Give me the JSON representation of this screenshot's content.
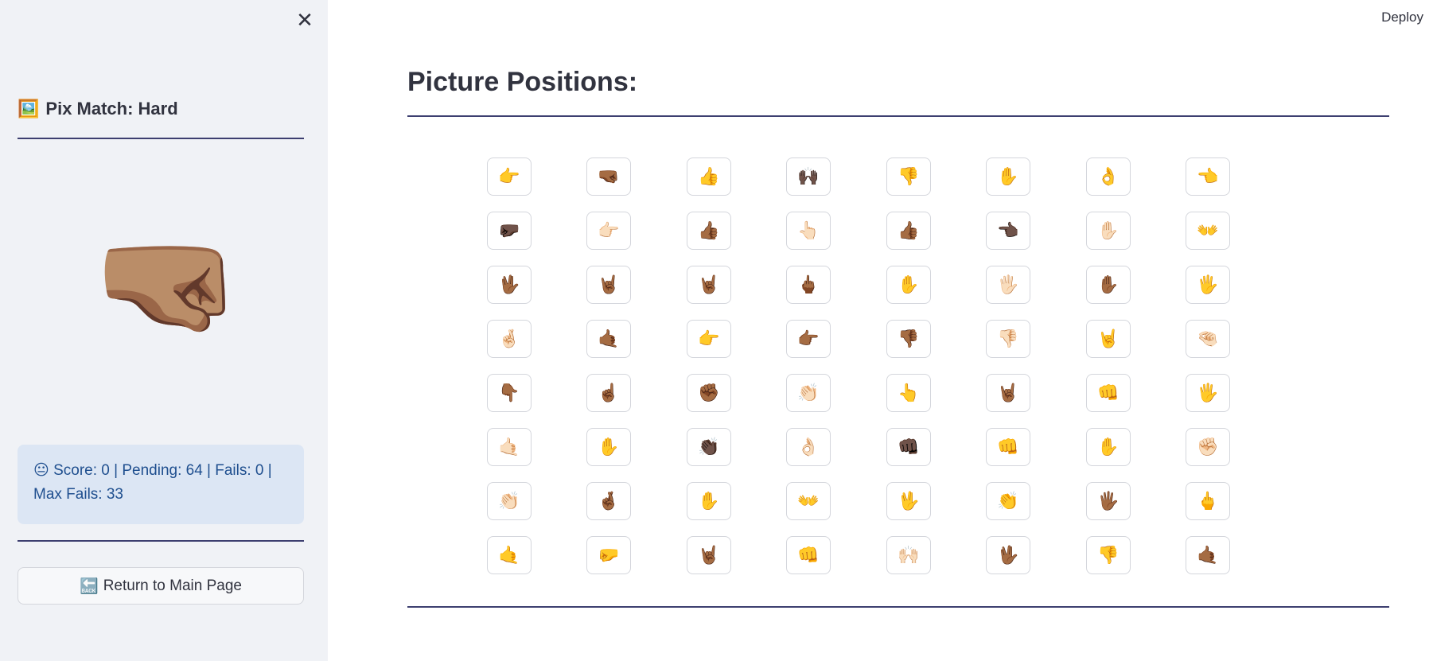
{
  "sidebar": {
    "close_icon": "✕",
    "title_icon": "🖼️",
    "title": "Pix Match: Hard",
    "target_emoji": "🤜🏽",
    "status_icon": "😐",
    "status_text": "Score: 0 | Pending: 64 | Fails: 0 | Max Fails: 33",
    "return_icon": "🔙",
    "return_label": "Return to Main Page"
  },
  "header": {
    "deploy_label": "Deploy"
  },
  "main": {
    "title": "Picture Positions:",
    "rows": [
      [
        "👉",
        "🤜🏾",
        "👍",
        "🙌🏿",
        "👎",
        "✋",
        "👌",
        "👈"
      ],
      [
        "🤛🏿",
        "👉🏻",
        "👍🏾",
        "👆🏻",
        "👍🏾",
        "👈🏿",
        "✋🏻",
        "👐"
      ],
      [
        "🖖🏾",
        "🤘🏾",
        "🤘🏾",
        "🖕🏾",
        "✋",
        "🖐🏻",
        "✋🏾",
        "🖐"
      ],
      [
        "🤞🏻",
        "🤙🏾",
        "👉",
        "👉🏾",
        "👎🏾",
        "👎🏻",
        "🤘",
        "🤏🏻"
      ],
      [
        "👇🏾",
        "☝🏾",
        "✊🏾",
        "👏🏻",
        "👆",
        "🤘🏾",
        "👊",
        "🖐"
      ],
      [
        "🤙🏻",
        "✋",
        "👏🏿",
        "👌🏻",
        "👊🏿",
        "👊",
        "✋",
        "✊🏻"
      ],
      [
        "👏🏻",
        "🤞🏾",
        "✋",
        "👐",
        "🖖",
        "👏",
        "🖐🏾",
        "🖕"
      ],
      [
        "🤙",
        "🤛",
        "🤘🏾",
        "👊",
        "🙌🏻",
        "🖖🏾",
        "👎",
        "🤙🏾"
      ]
    ]
  }
}
